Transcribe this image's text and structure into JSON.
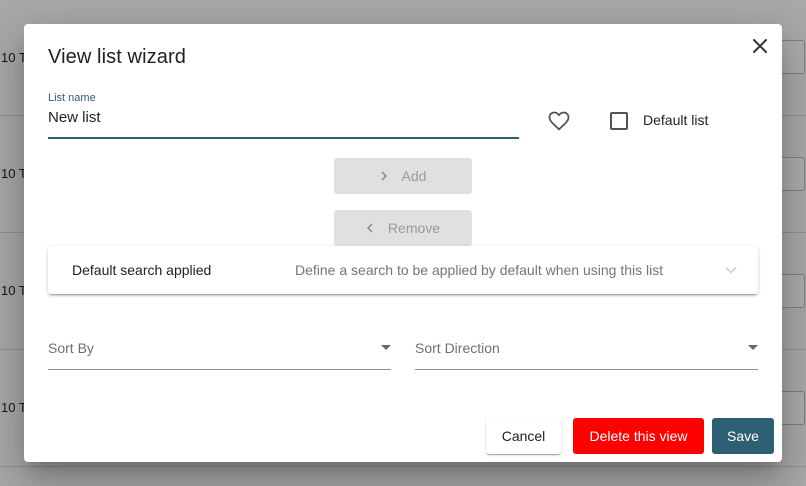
{
  "background": {
    "row_label": "10 T"
  },
  "dialog": {
    "title": "View list wizard",
    "list_name": {
      "label": "List name",
      "value": "New list"
    },
    "default_list_label": "Default list",
    "add_label": "Add",
    "remove_label": "Remove",
    "default_search": {
      "title": "Default search applied",
      "description": "Define a search to be applied by default when using this list"
    },
    "sort_by_placeholder": "Sort By",
    "sort_direction_placeholder": "Sort Direction",
    "actions": {
      "cancel": "Cancel",
      "delete": "Delete this view",
      "save": "Save"
    }
  },
  "icons": {
    "close": "close-icon",
    "favorite": "heart-outline-icon",
    "add": "chevron-right-icon",
    "remove": "chevron-left-icon",
    "expand": "chevron-down-icon"
  },
  "colors": {
    "primary": "#2c5f74",
    "danger": "#ff0000",
    "disabled_bg": "#e0e0e0"
  }
}
